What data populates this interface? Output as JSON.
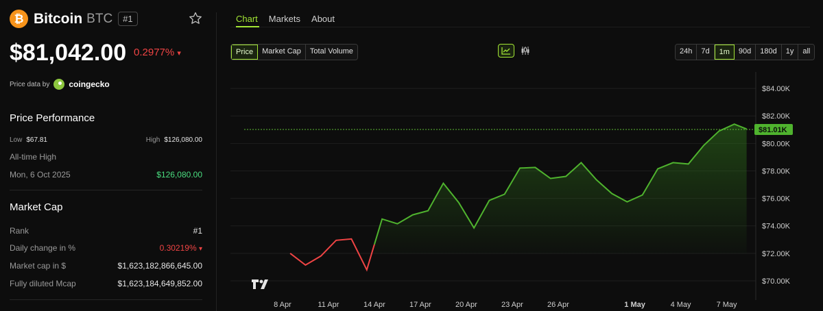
{
  "coin": {
    "logo_glyph": "₿",
    "name": "Bitcoin",
    "symbol": "BTC",
    "rank_badge": "#1",
    "price": "$81,042.00",
    "change": "0.2977%",
    "change_arrow": "▾",
    "price_data_by": "Price data by",
    "provider": "coingecko"
  },
  "performance": {
    "title": "Price Performance",
    "low_label": "Low",
    "low_value": "$67.81",
    "high_label": "High",
    "high_value": "$126,080.00",
    "ath_label": "All-time High",
    "ath_date": "Mon, 6 Oct 2025",
    "ath_value": "$126,080.00"
  },
  "market_cap": {
    "title": "Market Cap",
    "rows": [
      {
        "label": "Rank",
        "value": "#1"
      },
      {
        "label": "Daily change in %",
        "value": "0.30219%",
        "arrow": "▾"
      },
      {
        "label": "Market cap in $",
        "value": "$1,623,182,866,645.00"
      },
      {
        "label": "Fully diluted Mcap",
        "value": "$1,623,184,649,852.00"
      }
    ]
  },
  "tabs": [
    "Chart",
    "Markets",
    "About"
  ],
  "metric_buttons": [
    "Price",
    "Market Cap",
    "Total Volume"
  ],
  "range_buttons": [
    "24h",
    "7d",
    "1m",
    "90d",
    "180d",
    "1y",
    "all"
  ],
  "active_range": "1m",
  "colors": {
    "accent": "#a3e635",
    "up": "#4fb32e",
    "down": "#ef4444"
  },
  "icons": {
    "star": "star-icon",
    "line_chart": "line-chart-icon",
    "candle_chart": "candlestick-icon",
    "watermark": "tradingview-logo"
  },
  "chart_data": {
    "type": "line",
    "current_price_label": "$81.01K",
    "current_price": 81010,
    "ylim": [
      69000,
      85200
    ],
    "y_ticks": [
      84000,
      82000,
      80000,
      78000,
      76000,
      74000,
      72000,
      70000
    ],
    "y_tick_labels": [
      "$84.00K",
      "$82.00K",
      "$80.00K",
      "$78.00K",
      "$76.00K",
      "$74.00K",
      "$72.00K",
      "$70.00K"
    ],
    "x_tick_labels": [
      "8 Apr",
      "11 Apr",
      "14 Apr",
      "17 Apr",
      "20 Apr",
      "23 Apr",
      "26 Apr",
      "1 May",
      "4 May",
      "7 May"
    ],
    "x_tick_bold": [
      false,
      false,
      false,
      false,
      false,
      false,
      false,
      true,
      false,
      false
    ],
    "x_tick_days": [
      8,
      11,
      14,
      17,
      20,
      23,
      26,
      31,
      34,
      37
    ],
    "x_range_days": [
      8,
      38.3
    ],
    "points": [
      {
        "d": 8.5,
        "v": 72000
      },
      {
        "d": 9.5,
        "v": 71150
      },
      {
        "d": 10.5,
        "v": 71800
      },
      {
        "d": 11.5,
        "v": 72950
      },
      {
        "d": 12.5,
        "v": 73050
      },
      {
        "d": 13.5,
        "v": 70800
      },
      {
        "d": 14.5,
        "v": 74500
      },
      {
        "d": 15.5,
        "v": 74150
      },
      {
        "d": 16.5,
        "v": 74800
      },
      {
        "d": 17.5,
        "v": 75100
      },
      {
        "d": 18.5,
        "v": 77100
      },
      {
        "d": 19.5,
        "v": 75700
      },
      {
        "d": 20.5,
        "v": 73850
      },
      {
        "d": 21.5,
        "v": 75850
      },
      {
        "d": 22.5,
        "v": 76300
      },
      {
        "d": 23.5,
        "v": 78200
      },
      {
        "d": 24.5,
        "v": 78250
      },
      {
        "d": 25.5,
        "v": 77450
      },
      {
        "d": 26.5,
        "v": 77600
      },
      {
        "d": 27.5,
        "v": 78600
      },
      {
        "d": 28.5,
        "v": 77350
      },
      {
        "d": 29.5,
        "v": 76350
      },
      {
        "d": 30.5,
        "v": 75750
      },
      {
        "d": 31.5,
        "v": 76250
      },
      {
        "d": 32.5,
        "v": 78150
      },
      {
        "d": 33.5,
        "v": 78600
      },
      {
        "d": 34.5,
        "v": 78500
      },
      {
        "d": 35.5,
        "v": 79850
      },
      {
        "d": 36.5,
        "v": 80900
      },
      {
        "d": 37.5,
        "v": 81400
      },
      {
        "d": 38.3,
        "v": 81050
      }
    ],
    "down_until_index": 6,
    "grid": true
  }
}
